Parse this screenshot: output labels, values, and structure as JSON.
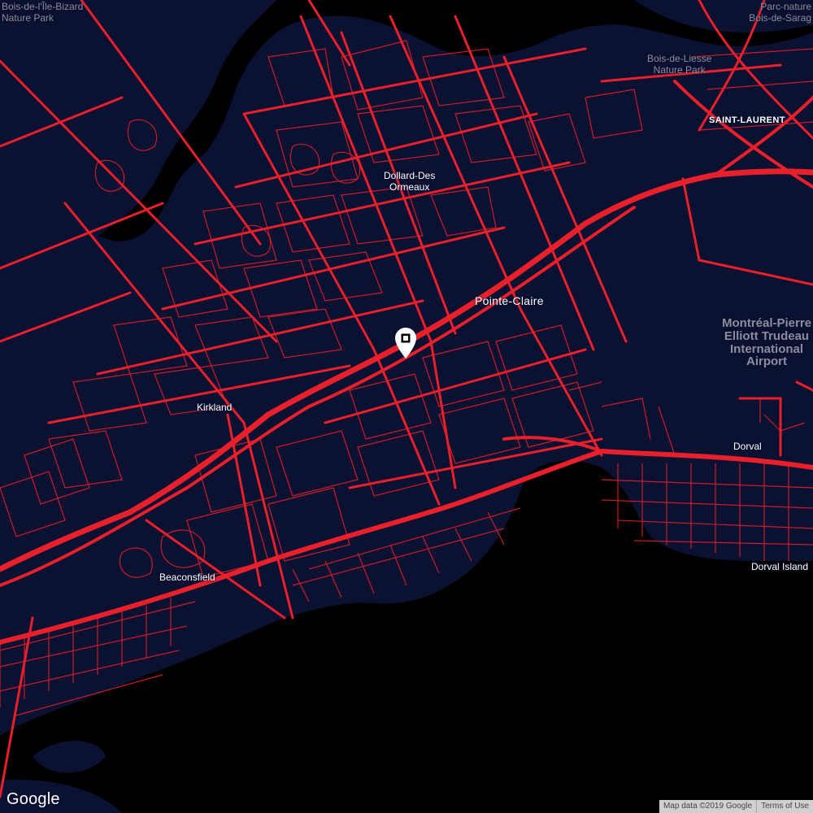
{
  "map": {
    "colors": {
      "land": "#0b1131",
      "water": "#000000",
      "road": "#e8202c",
      "label": "#ffffff",
      "poi_label": "#8a8e9c"
    },
    "labels": {
      "bois_ile_bizard": [
        "Bois-de-l'Île-Bizard",
        "Nature Park"
      ],
      "parc_nature_bois_saraguay": [
        "Parc-nature",
        "Bois-de-Sarag"
      ],
      "bois_de_liesse": [
        "Bois-de-Liesse",
        "Nature Park"
      ],
      "saint_laurent": "SAINT-LAURENT",
      "dollard_des_ormeaux": [
        "Dollard-Des",
        "Ormeaux"
      ],
      "pointe_claire": "Pointe-Claire",
      "airport": [
        "Montréal-Pierre",
        "Elliott Trudeau",
        "International",
        "Airport"
      ],
      "kirkland": "Kirkland",
      "dorval": "Dorval",
      "beaconsfield": "Beaconsfield",
      "dorval_island": "Dorval Island"
    },
    "marker": {
      "icon": "map-pin-icon"
    },
    "footer": {
      "logo": "Google",
      "map_data": "Map data ©2019 Google",
      "terms": "Terms of Use"
    }
  }
}
